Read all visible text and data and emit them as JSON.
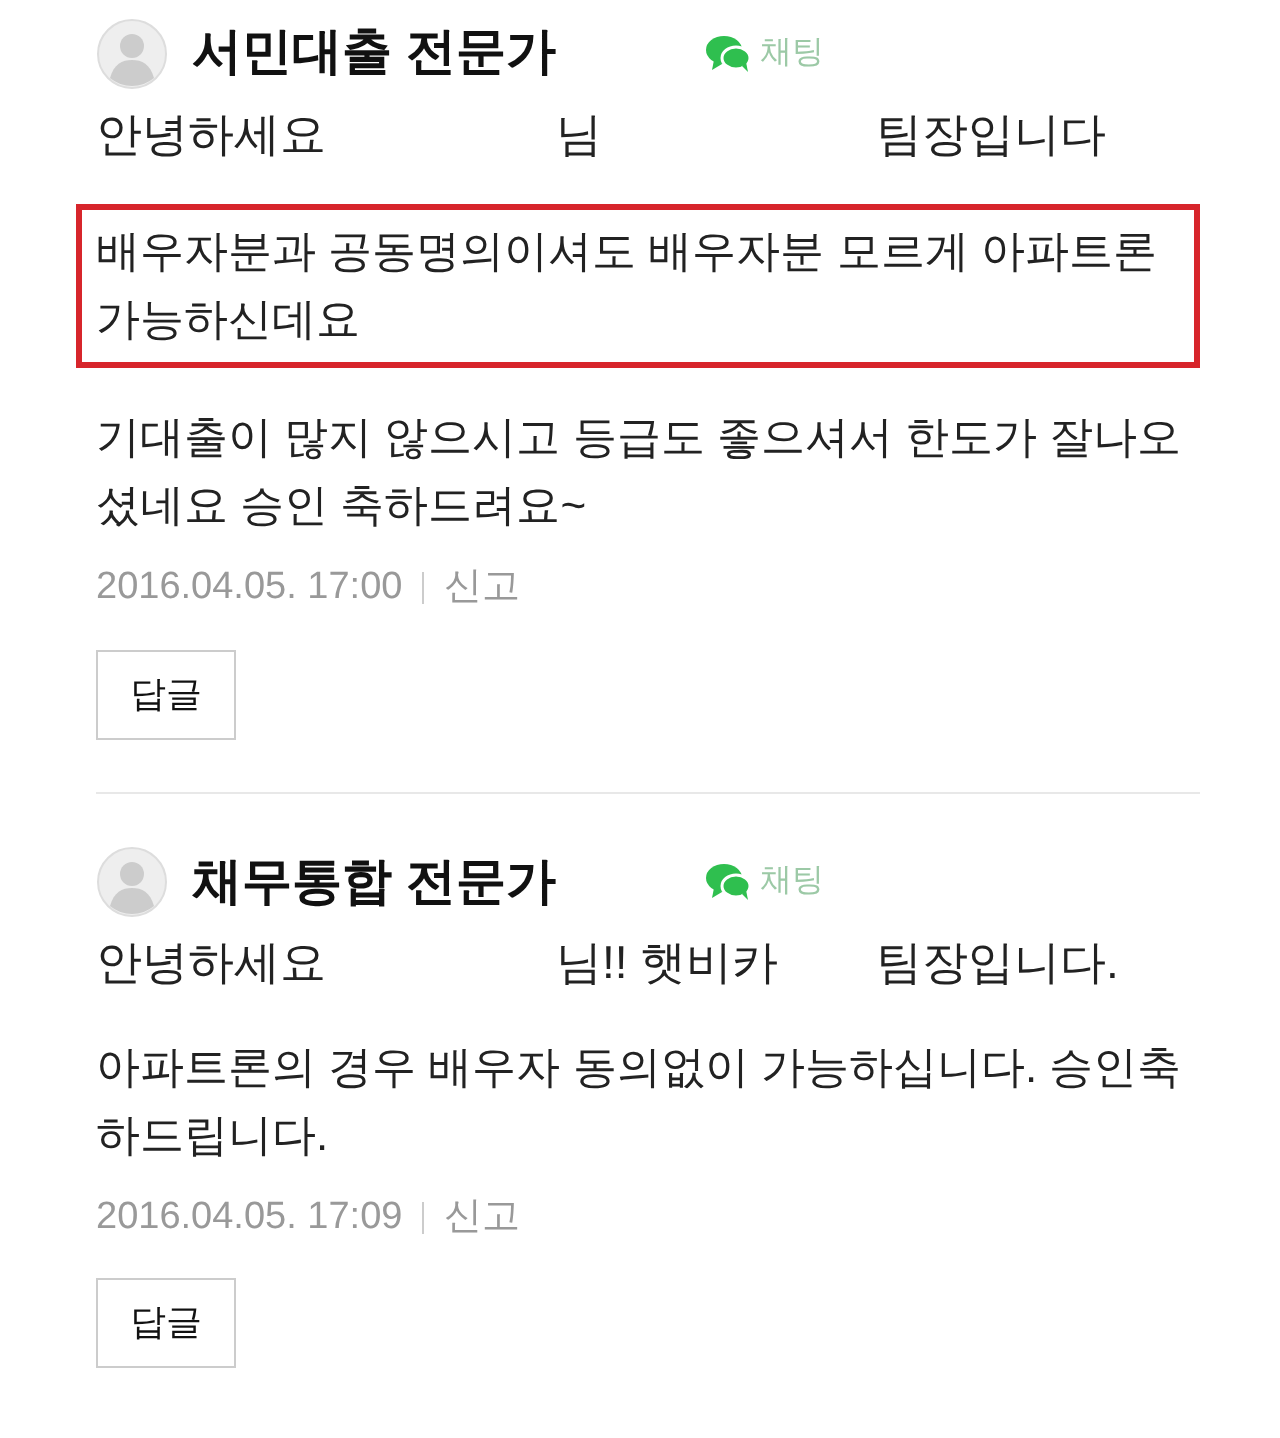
{
  "comments": [
    {
      "author": "서민대출 전문가",
      "chat_label": "채팅",
      "greeting": [
        "안녕하세요",
        "님",
        "팀장입니다"
      ],
      "paragraphs": [
        {
          "text": "배우자분과 공동명의이셔도 배우자분 모르게 아파트론 가능하신데요",
          "highlighted": true
        },
        {
          "text": "기대출이 많지 않으시고 등급도 좋으셔서 한도가 잘나오셨네요 승인 축하드려요~",
          "highlighted": false
        }
      ],
      "date": "2016.04.05. 17:00",
      "report": "신고",
      "reply": "답글"
    },
    {
      "author": "채무통합 전문가",
      "chat_label": "채팅",
      "greeting": [
        "안녕하세요",
        "님!! 햇비카",
        "팀장입니다."
      ],
      "paragraphs": [
        {
          "text": "아파트론의 경우 배우자 동의없이 가능하십니다. 승인축하드립니다.",
          "highlighted": false
        }
      ],
      "date": "2016.04.05. 17:09",
      "report": "신고",
      "reply": "답글"
    }
  ]
}
